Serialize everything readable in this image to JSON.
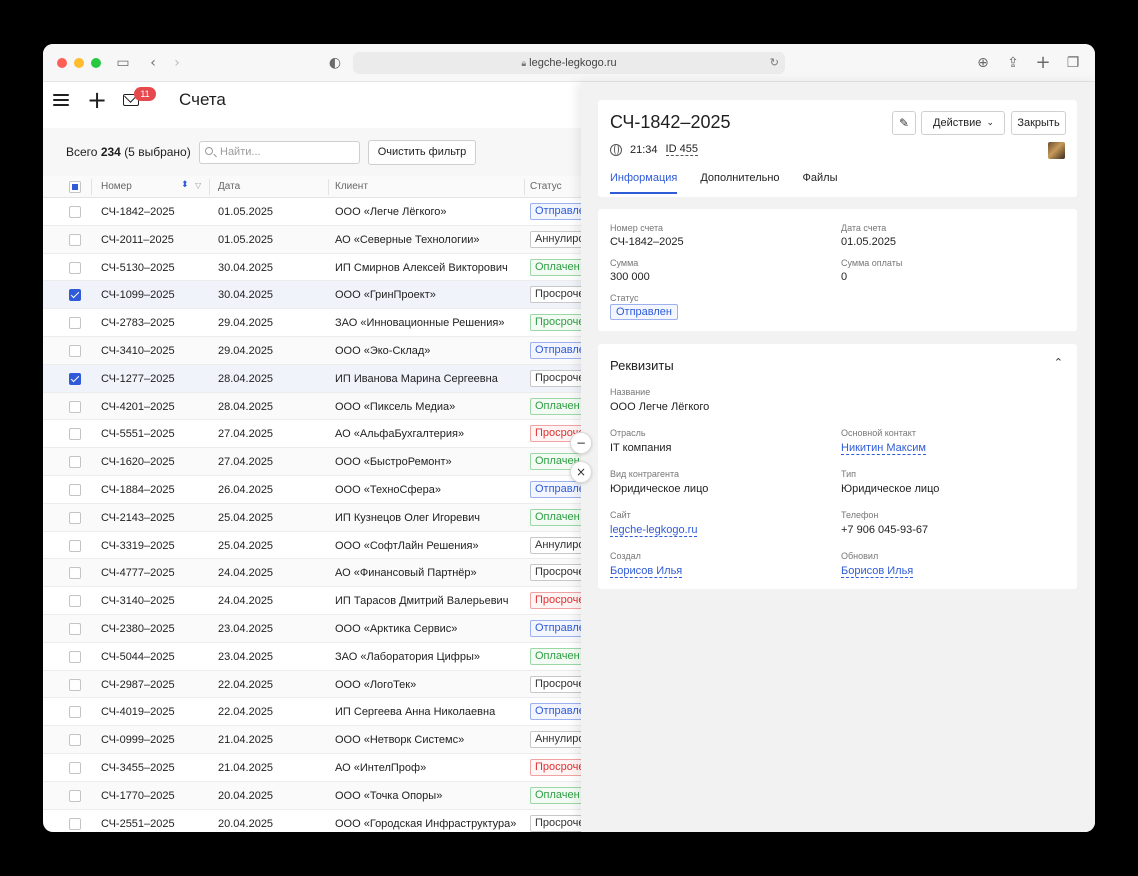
{
  "browser": {
    "url": "legche-legkogo.ru"
  },
  "header": {
    "title": "Счета",
    "mail_badge": "11"
  },
  "toolbar": {
    "total_label": "Всего",
    "total_count": "234",
    "selected_text": "(5 выбрано)",
    "search_placeholder": "Найти...",
    "clear_label": "Очистить фильтр"
  },
  "table": {
    "columns": [
      "Номер",
      "Дата",
      "Клиент",
      "Статус"
    ],
    "rows": [
      {
        "num": "СЧ-1842–2025",
        "date": "01.05.2025",
        "client": "ООО «Легче Лёгкого»",
        "status": "Отправлен",
        "color": "blue",
        "checked": false
      },
      {
        "num": "СЧ-2011–2025",
        "date": "01.05.2025",
        "client": "АО «Северные Технологии»",
        "status": "Аннулирован",
        "color": "gray",
        "checked": false
      },
      {
        "num": "СЧ-5130–2025",
        "date": "30.04.2025",
        "client": "ИП Смирнов Алексей Викторович",
        "status": "Оплачен",
        "color": "green",
        "checked": false
      },
      {
        "num": "СЧ-1099–2025",
        "date": "30.04.2025",
        "client": "ООО «ГринПроект»",
        "status": "Просрочен",
        "color": "gray",
        "checked": true
      },
      {
        "num": "СЧ-2783–2025",
        "date": "29.04.2025",
        "client": "ЗАО «Инновационные Решения»",
        "status": "Просрочен",
        "color": "green",
        "checked": false
      },
      {
        "num": "СЧ-3410–2025",
        "date": "29.04.2025",
        "client": "ООО «Эко-Склад»",
        "status": "Отправлен",
        "color": "blue",
        "checked": false
      },
      {
        "num": "СЧ-1277–2025",
        "date": "28.04.2025",
        "client": "ИП Иванова Марина Сергеевна",
        "status": "Просрочен",
        "color": "gray",
        "checked": true
      },
      {
        "num": "СЧ-4201–2025",
        "date": "28.04.2025",
        "client": "ООО «Пиксель Медиа»",
        "status": "Оплачен",
        "color": "green",
        "checked": false
      },
      {
        "num": "СЧ-5551–2025",
        "date": "27.04.2025",
        "client": "АО «АльфаБухгалтерия»",
        "status": "Просрочен",
        "color": "red",
        "checked": false
      },
      {
        "num": "СЧ-1620–2025",
        "date": "27.04.2025",
        "client": "ООО «БыстроРемонт»",
        "status": "Оплачен",
        "color": "green",
        "checked": false
      },
      {
        "num": "СЧ-1884–2025",
        "date": "26.04.2025",
        "client": "ООО «ТехноСфера»",
        "status": "Отправлен",
        "color": "blue",
        "checked": false
      },
      {
        "num": "СЧ-2143–2025",
        "date": "25.04.2025",
        "client": "ИП Кузнецов Олег Игоревич",
        "status": "Оплачен",
        "color": "green",
        "checked": false
      },
      {
        "num": "СЧ-3319–2025",
        "date": "25.04.2025",
        "client": "ООО «СофтЛайн Решения»",
        "status": "Аннулирован",
        "color": "gray",
        "checked": false
      },
      {
        "num": "СЧ-4777–2025",
        "date": "24.04.2025",
        "client": "АО «Финансовый Партнёр»",
        "status": "Просрочен",
        "color": "gray",
        "checked": false
      },
      {
        "num": "СЧ-3140–2025",
        "date": "24.04.2025",
        "client": "ИП Тарасов Дмитрий Валерьевич",
        "status": "Просрочен",
        "color": "red",
        "checked": false
      },
      {
        "num": "СЧ-2380–2025",
        "date": "23.04.2025",
        "client": "ООО «Арктика Сервис»",
        "status": "Отправлен",
        "color": "blue",
        "checked": false
      },
      {
        "num": "СЧ-5044–2025",
        "date": "23.04.2025",
        "client": "ЗАО «Лаборатория Цифры»",
        "status": "Оплачен",
        "color": "green",
        "checked": false
      },
      {
        "num": "СЧ-2987–2025",
        "date": "22.04.2025",
        "client": "ООО «ЛогоТек»",
        "status": "Просрочен",
        "color": "gray",
        "checked": false
      },
      {
        "num": "СЧ-4019–2025",
        "date": "22.04.2025",
        "client": "ИП Сергеева Анна Николаевна",
        "status": "Отправлен",
        "color": "blue",
        "checked": false
      },
      {
        "num": "СЧ-0999–2025",
        "date": "21.04.2025",
        "client": "ООО «Нетворк Системс»",
        "status": "Аннулирован",
        "color": "gray",
        "checked": false
      },
      {
        "num": "СЧ-3455–2025",
        "date": "21.04.2025",
        "client": "АО «ИнтелПроф»",
        "status": "Просрочен",
        "color": "red",
        "checked": false
      },
      {
        "num": "СЧ-1770–2025",
        "date": "20.04.2025",
        "client": "ООО «Точка Опоры»",
        "status": "Оплачен",
        "color": "green",
        "checked": false
      },
      {
        "num": "СЧ-2551–2025",
        "date": "20.04.2025",
        "client": "ООО «Городская Инфраструктура»",
        "status": "Просрочен",
        "color": "gray",
        "checked": false
      }
    ]
  },
  "panel": {
    "title": "СЧ-1842–2025",
    "time": "21:34",
    "id": "ID 455",
    "action_label": "Действие",
    "close_label": "Закрыть",
    "tabs": [
      "Информация",
      "Дополнительно",
      "Файлы"
    ],
    "info": {
      "number_label": "Номер счета",
      "number": "СЧ-1842–2025",
      "date_label": "Дата счета",
      "date": "01.05.2025",
      "sum_label": "Сумма",
      "sum": "300 000",
      "paid_label": "Сумма оплаты",
      "paid": "0",
      "status_label": "Статус",
      "status": "Отправлен"
    },
    "details": {
      "title": "Реквизиты",
      "name_label": "Название",
      "name": "ООО Легче Лёгкого",
      "industry_label": "Отрасль",
      "industry": "IT компания",
      "contact_label": "Основной контакт",
      "contact": "Никитин Максим",
      "kind_label": "Вид контрагента",
      "kind": "Юридическое лицо",
      "type_label": "Тип",
      "type": "Юридическое лицо",
      "site_label": "Сайт",
      "site": "legche-legkogo.ru",
      "phone_label": "Телефон",
      "phone": "+7 906 045-93-67",
      "created_label": "Создал",
      "created": "Борисов Илья",
      "updated_label": "Обновил",
      "updated": "Борисов Илья"
    }
  },
  "colors": {
    "accent": "#2f5bd8",
    "green": "#2f9e44",
    "red": "#e03131",
    "badge": "#e5484d"
  }
}
